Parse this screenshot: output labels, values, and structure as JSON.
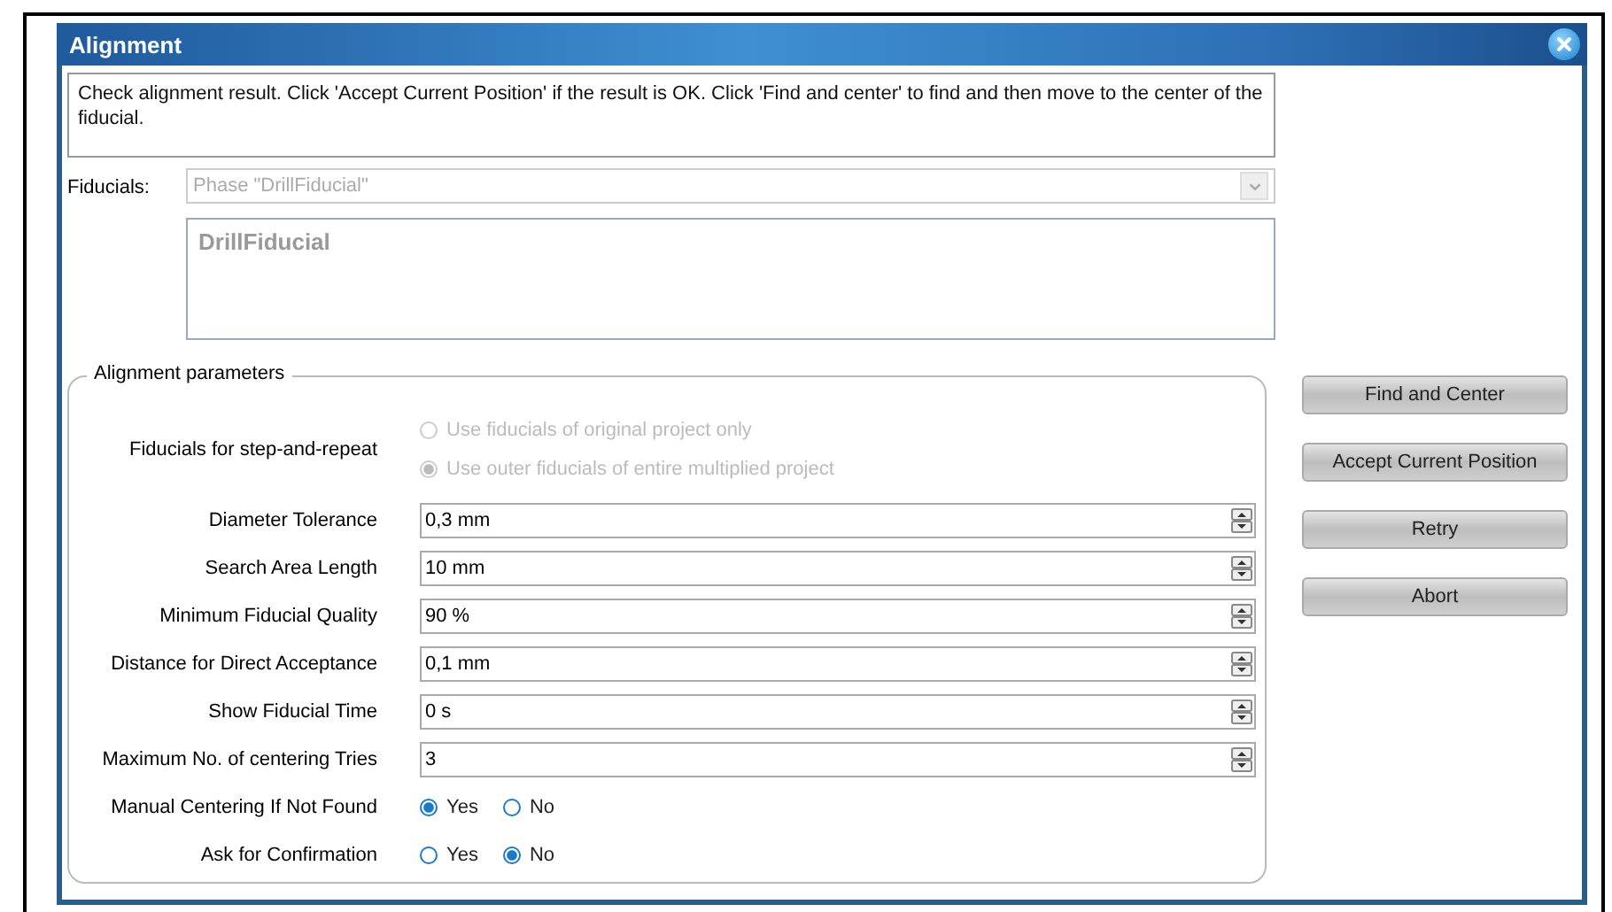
{
  "window": {
    "title": "Alignment"
  },
  "message": "Check alignment result. Click 'Accept Current Position' if the result is OK. Click 'Find and center' to find and then move to the center of the fiducial.",
  "fiducials": {
    "label": "Fiducials:",
    "dropdown": {
      "value": "Phase \"DrillFiducial\"",
      "disabled": true
    },
    "list": [
      "DrillFiducial"
    ]
  },
  "parameters": {
    "title": "Alignment parameters",
    "rows": [
      {
        "kind": "radio-stack",
        "label": "Fiducials for step-and-repeat",
        "disabled": true,
        "options": [
          {
            "label": "Use fiducials of original project only",
            "selected": false
          },
          {
            "label": "Use outer fiducials of entire multiplied project",
            "selected": true
          }
        ]
      },
      {
        "kind": "spinner",
        "label": "Diameter Tolerance",
        "value": "0,3 mm"
      },
      {
        "kind": "spinner",
        "label": "Search Area Length",
        "value": "10 mm"
      },
      {
        "kind": "spinner",
        "label": "Minimum Fiducial Quality",
        "value": "90 %"
      },
      {
        "kind": "spinner",
        "label": "Distance for Direct Acceptance",
        "value": "0,1 mm"
      },
      {
        "kind": "spinner",
        "label": "Show Fiducial Time",
        "value": "0 s"
      },
      {
        "kind": "spinner",
        "label": "Maximum No. of centering Tries",
        "value": "3"
      },
      {
        "kind": "radio-inline",
        "label": "Manual Centering If Not Found",
        "disabled": false,
        "options": [
          {
            "label": "Yes",
            "selected": true
          },
          {
            "label": "No",
            "selected": false
          }
        ]
      },
      {
        "kind": "radio-inline",
        "label": "Ask for Confirmation",
        "disabled": false,
        "options": [
          {
            "label": "Yes",
            "selected": false
          },
          {
            "label": "No",
            "selected": true
          }
        ]
      }
    ]
  },
  "buttons": [
    "Find and Center",
    "Accept Current Position",
    "Retry",
    "Abort"
  ]
}
